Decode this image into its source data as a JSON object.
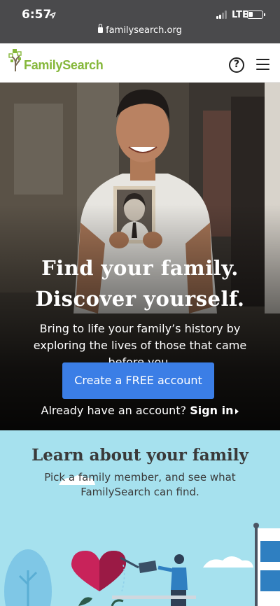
{
  "status_bar": {
    "time": "6:57",
    "location_icon": "location-arrow-icon",
    "network": "LTE",
    "url": "familysearch.org"
  },
  "header": {
    "logo_text": "FamilySearch",
    "help_label": "?"
  },
  "hero": {
    "title_line1": "Find your family.",
    "title_line2": "Discover yourself.",
    "subtitle": "Bring to life your family’s history by exploring the lives of those that came before you.",
    "cta_label": "Create a FREE account",
    "signin_prompt": "Already have an account?",
    "signin_label": "Sign in"
  },
  "learn": {
    "title": "Learn about your family",
    "subtitle": "Pick a family member, and see what FamilySearch can find."
  },
  "colors": {
    "brand_green": "#85b73a",
    "cta_blue": "#3b7ee6",
    "learn_bg": "#a6e1ee"
  }
}
